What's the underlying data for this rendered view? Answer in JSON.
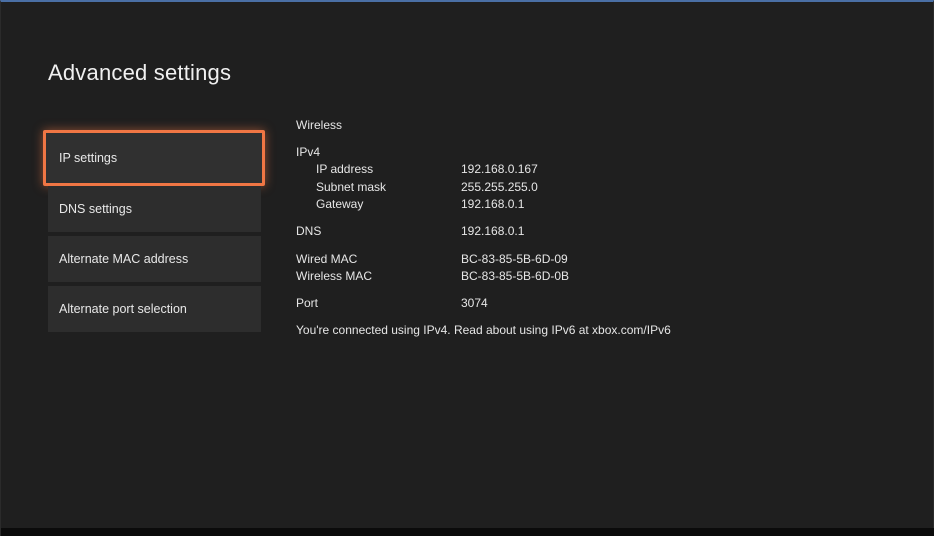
{
  "page": {
    "title": "Advanced settings"
  },
  "menu": {
    "items": [
      {
        "label": "IP settings",
        "selected": true
      },
      {
        "label": "DNS settings",
        "selected": false
      },
      {
        "label": "Alternate MAC address",
        "selected": false
      },
      {
        "label": "Alternate port selection",
        "selected": false
      }
    ]
  },
  "details": {
    "connection_type": "Wireless",
    "ipv4_heading": "IPv4",
    "ip_address": {
      "label": "IP address",
      "value": "192.168.0.167"
    },
    "subnet_mask": {
      "label": "Subnet mask",
      "value": "255.255.255.0"
    },
    "gateway": {
      "label": "Gateway",
      "value": "192.168.0.1"
    },
    "dns": {
      "label": "DNS",
      "value": "192.168.0.1"
    },
    "wired_mac": {
      "label": "Wired MAC",
      "value": "BC-83-85-5B-6D-09"
    },
    "wireless_mac": {
      "label": "Wireless MAC",
      "value": "BC-83-85-5B-6D-0B"
    },
    "port": {
      "label": "Port",
      "value": "3074"
    },
    "footer_note": "You're connected using IPv4. Read about using IPv6 at xbox.com/IPv6"
  },
  "colors": {
    "background": "#1f1f1f",
    "menu_item_bg": "#2d2d2d",
    "selection_highlight": "#f07644",
    "title_border": "#4a6fa5"
  }
}
